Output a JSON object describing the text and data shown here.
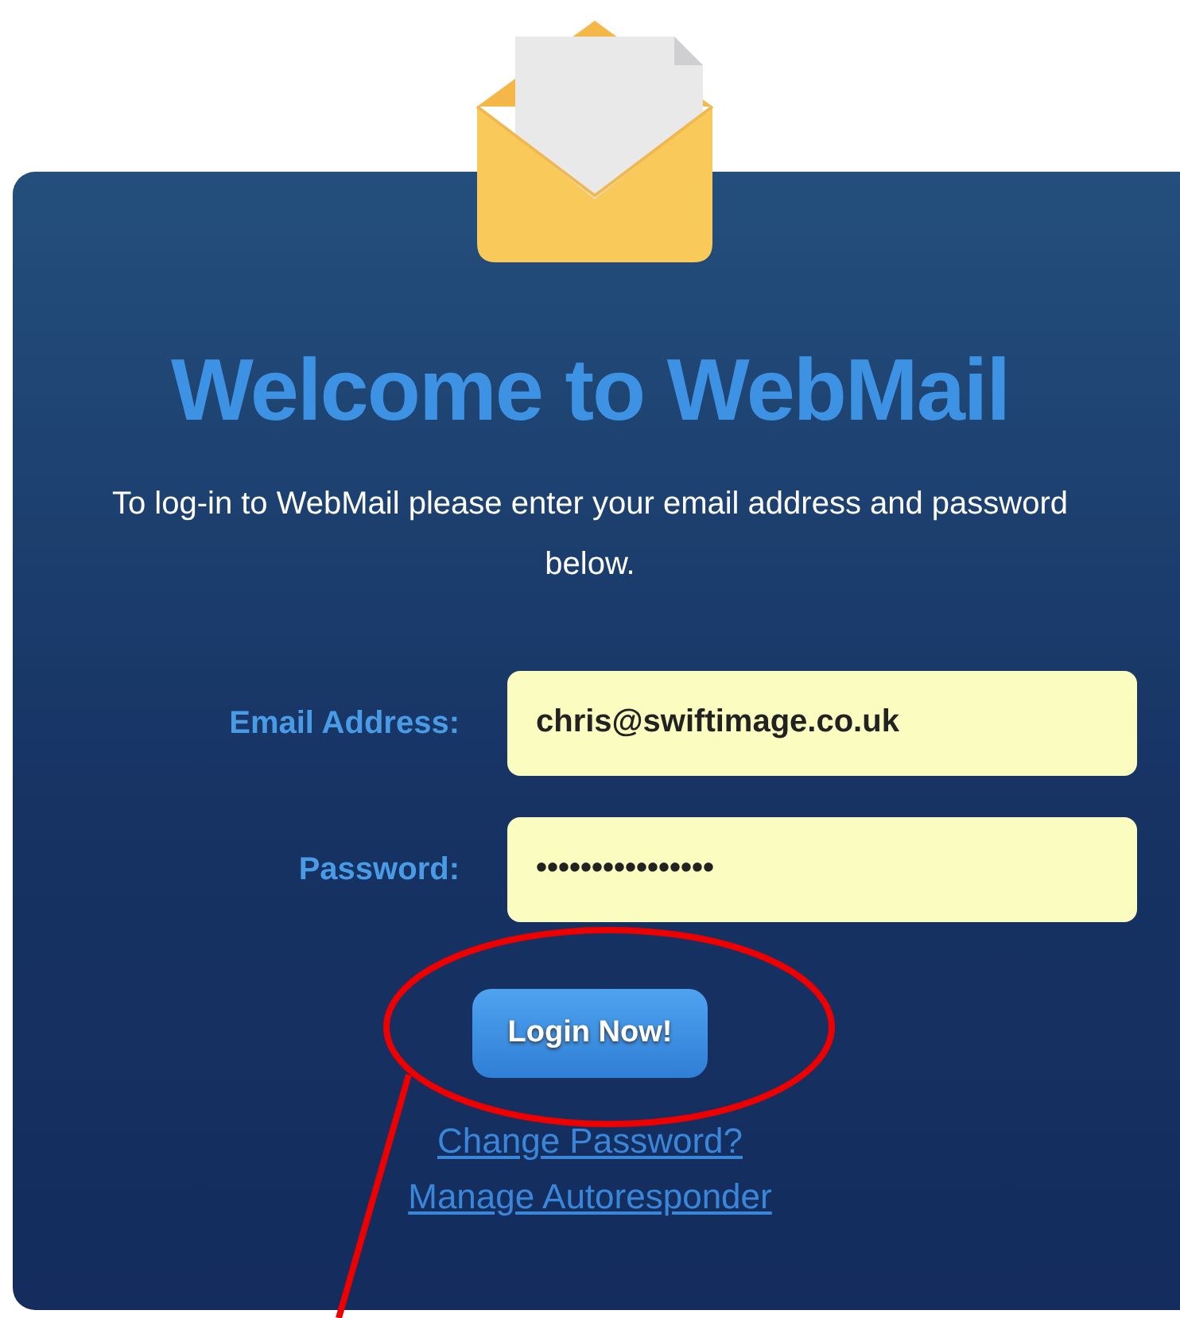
{
  "title": "Welcome to WebMail",
  "intro": "To log-in to WebMail please enter your email address and password below.",
  "fields": [
    {
      "label": "Email Address:",
      "value": "chris@swiftimage.co.uk"
    },
    {
      "label": "Password:",
      "value": "••••••••••••••••"
    }
  ],
  "button": "Login Now!",
  "links": [
    "Change Password?",
    "Manage Autoresponder"
  ]
}
